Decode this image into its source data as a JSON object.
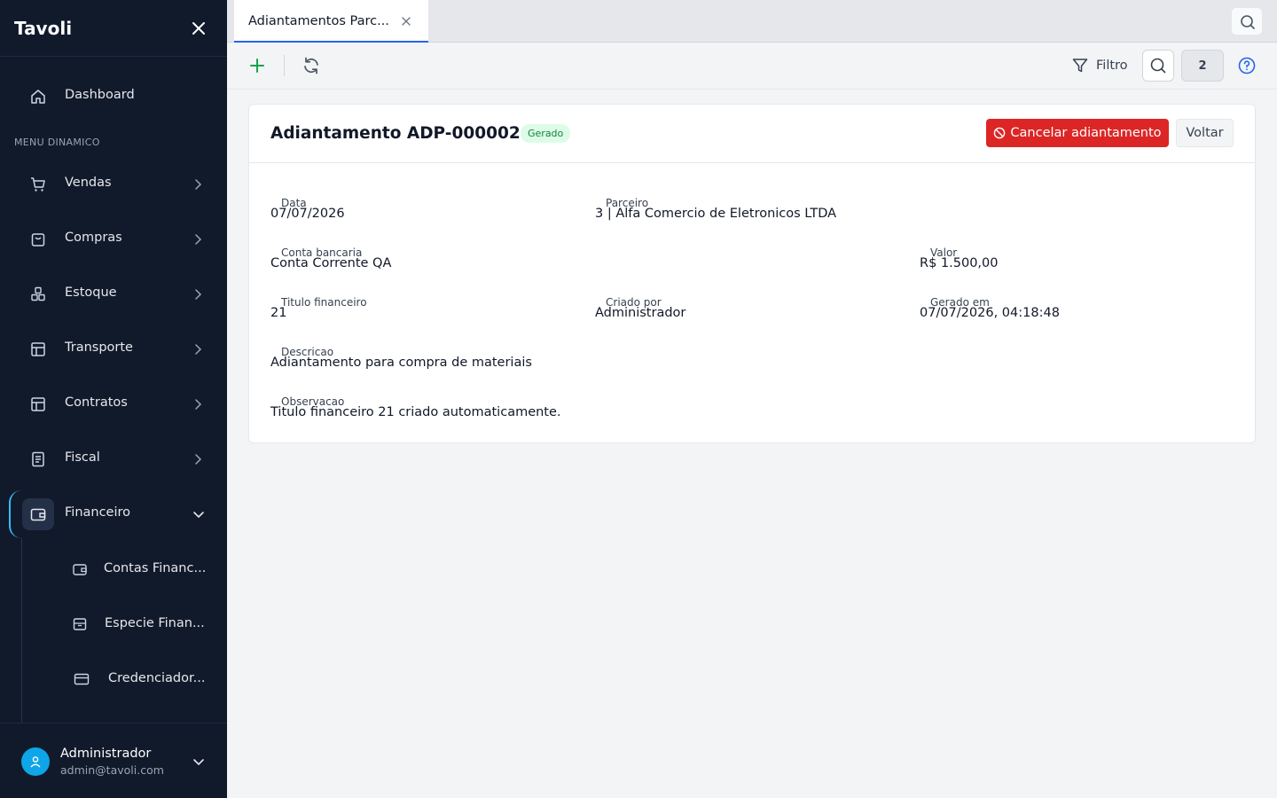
{
  "sidebar": {
    "brand": "Tavoli",
    "dashboard_label": "Dashboard",
    "section_label": "MENU DINAMICO",
    "items": [
      {
        "label": "Vendas"
      },
      {
        "label": "Compras"
      },
      {
        "label": "Estoque"
      },
      {
        "label": "Transporte"
      },
      {
        "label": "Contratos"
      },
      {
        "label": "Fiscal"
      },
      {
        "label": "Financeiro"
      }
    ],
    "sub_items": [
      {
        "label": "Contas Financ..."
      },
      {
        "label": "Especie Finan..."
      },
      {
        "label": "Credenciador..."
      }
    ],
    "user": {
      "name": "Administrador",
      "email": "admin@tavoli.com"
    }
  },
  "tabs": [
    {
      "label": "Adiantamentos Parc..."
    }
  ],
  "toolbar": {
    "filter_label": "Filtro",
    "count": "2"
  },
  "card": {
    "title": "Adiantamento ADP-000002",
    "status": "Gerado",
    "cancel_label": "Cancelar adiantamento",
    "back_label": "Voltar",
    "fields": {
      "data": {
        "label": "Data",
        "value": "07/07/2026"
      },
      "parceiro": {
        "label": "Parceiro",
        "value": "3 | Alfa Comercio de Eletronicos LTDA"
      },
      "conta": {
        "label": "Conta bancaria",
        "value": "Conta Corrente QA"
      },
      "valor": {
        "label": "Valor",
        "value": "R$ 1.500,00"
      },
      "titulo": {
        "label": "Titulo financeiro",
        "value": "21"
      },
      "criado": {
        "label": "Criado por",
        "value": "Administrador"
      },
      "gerado": {
        "label": "Gerado em",
        "value": "07/07/2026, 04:18:48"
      },
      "descricao": {
        "label": "Descricao",
        "value": "Adiantamento para compra de materiais"
      },
      "observacao": {
        "label": "Observacao",
        "value": "Titulo financeiro 21 criado automaticamente."
      }
    }
  },
  "colors": {
    "sidebar_bg": "#111a2b",
    "accent": "#2563eb",
    "danger": "#dc2626",
    "active_rail": "#38bdf8",
    "status_bg": "#dcfce7",
    "status_fg": "#15803d"
  }
}
